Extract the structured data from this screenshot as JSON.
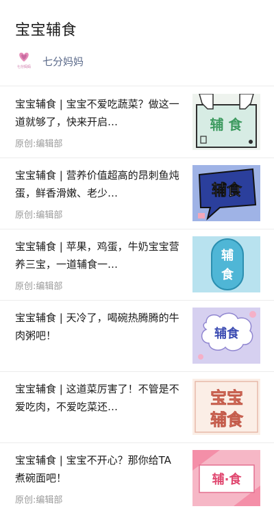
{
  "header": {
    "title": "宝宝辅食",
    "account_name": "七分妈妈",
    "account_logo_text": "七分妈妈"
  },
  "articles": [
    {
      "title": "宝宝辅食 | 宝宝不爱吃蔬菜？做这一道就够了，快来开启…",
      "source": "原创:编辑部",
      "thumb_text": "辅 食",
      "thumb_icon": "hands-holding-sign-icon"
    },
    {
      "title": "宝宝辅食 | 营养价值超高的昂刺鱼炖蛋，鲜香滑嫩、老少…",
      "source": "原创:编辑部",
      "thumb_text": "辅食",
      "thumb_icon": "speech-bubble-icon"
    },
    {
      "title": "宝宝辅食 | 苹果，鸡蛋，牛奶宝宝营养三宝，一道辅食一…",
      "source": "原创:编辑部",
      "thumb_text_1": "辅",
      "thumb_text_2": "食",
      "thumb_icon": "pill-shape-icon"
    },
    {
      "title": "宝宝辅食 | 天冷了，喝碗热腾腾的牛肉粥吧！",
      "source": "",
      "thumb_text": "辅食",
      "thumb_icon": "cloud-bubble-icon"
    },
    {
      "title": "宝宝辅食 | 这道菜厉害了！不管是不爱吃肉，不爱吃菜还…",
      "source": "",
      "thumb_text_1": "宝宝",
      "thumb_text_2": "辅食",
      "thumb_icon": "bold-text-card-icon"
    },
    {
      "title": "宝宝辅食 | 宝宝不开心？那你给TA煮碗面吧！",
      "source": "原创:编辑部",
      "thumb_text": "辅·食",
      "thumb_icon": "label-card-icon"
    }
  ],
  "colors": {
    "account_name": "#5b6a8a",
    "source_text": "#9a9a9a",
    "divider": "#ececec"
  }
}
